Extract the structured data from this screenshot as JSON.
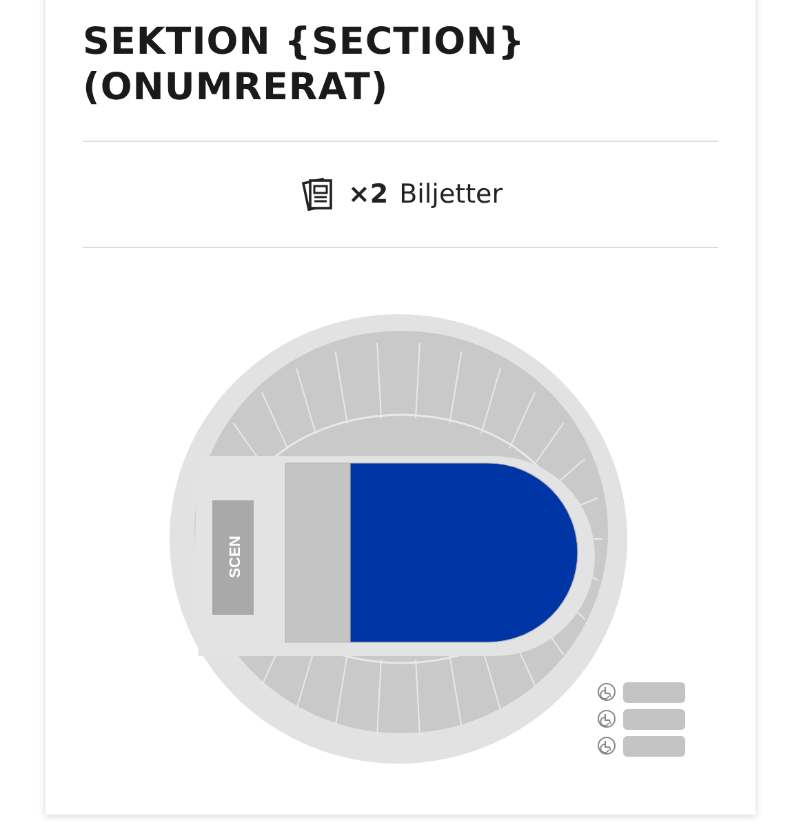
{
  "title": "SEKTION {SECTION} (ONUMRERAT)",
  "tickets": {
    "count": "×2",
    "label": "Biljetter"
  },
  "map": {
    "stage_label": "SCEN",
    "sections": [
      {
        "kind": "standing",
        "selected": false
      },
      {
        "kind": "floor",
        "selected": true
      }
    ]
  }
}
